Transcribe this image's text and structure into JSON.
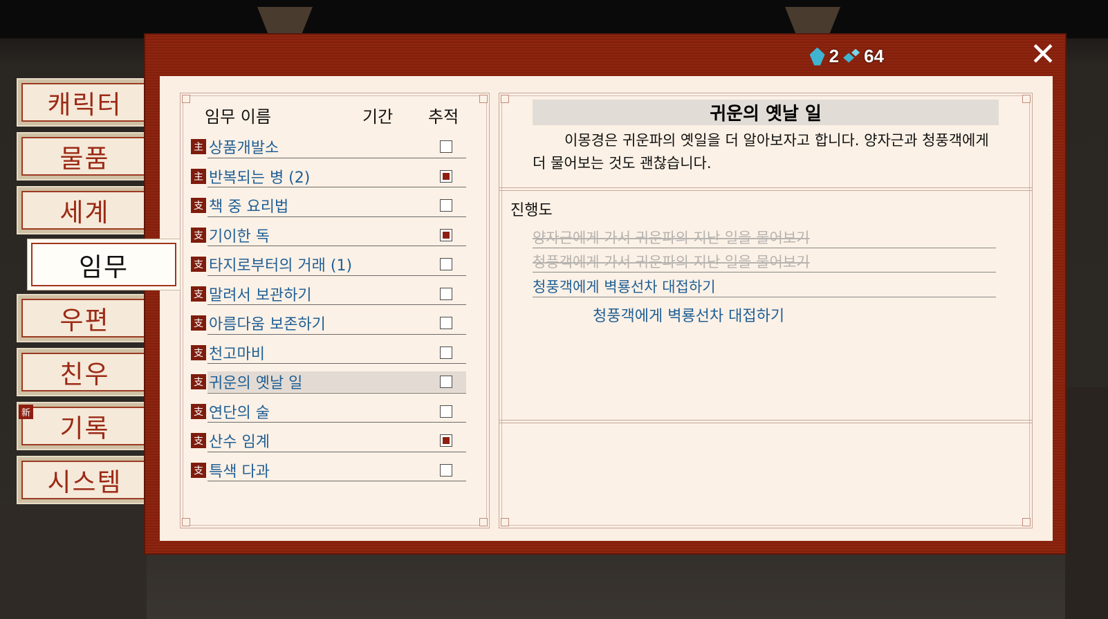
{
  "tabs": [
    {
      "label": "캐릭터",
      "active": false
    },
    {
      "label": "물품",
      "active": false
    },
    {
      "label": "세계",
      "active": false
    },
    {
      "label": "임무",
      "active": true
    },
    {
      "label": "우편",
      "active": false
    },
    {
      "label": "친우",
      "active": false
    },
    {
      "label": "기록",
      "active": false
    },
    {
      "label": "시스템",
      "active": false
    }
  ],
  "new_badge": "新",
  "currency": {
    "gems": "2",
    "gem_shards": "64"
  },
  "quest_list": {
    "header": {
      "name": "임무 이름",
      "period": "기간",
      "track": "추적"
    },
    "quests": [
      {
        "type": "主",
        "name": "상품개발소",
        "tracked": false
      },
      {
        "type": "主",
        "name": "반복되는 병 (2)",
        "tracked": true
      },
      {
        "type": "支",
        "name": "책 중 요리법",
        "tracked": false
      },
      {
        "type": "支",
        "name": "기이한 독",
        "tracked": true
      },
      {
        "type": "支",
        "name": "타지로부터의 거래 (1)",
        "tracked": false
      },
      {
        "type": "支",
        "name": "말려서 보관하기",
        "tracked": false
      },
      {
        "type": "支",
        "name": "아름다움 보존하기",
        "tracked": false
      },
      {
        "type": "支",
        "name": "천고마비",
        "tracked": false
      },
      {
        "type": "支",
        "name": "귀운의 옛날 일",
        "tracked": false,
        "selected": true
      },
      {
        "type": "支",
        "name": "연단의 술",
        "tracked": false
      },
      {
        "type": "支",
        "name": "산수 임계",
        "tracked": true
      },
      {
        "type": "支",
        "name": "특색 다과",
        "tracked": false
      }
    ]
  },
  "detail": {
    "title": "귀운의 옛날 일",
    "description": "이몽경은 귀운파의 옛일을 더 알아보자고 합니다. 양자근과 청풍객에게 더 물어보는 것도 괜찮습니다.",
    "progress_label": "진행도",
    "steps": [
      {
        "text": "양자근에게 가서 귀운파의 지난 일을 물어보기",
        "done": true
      },
      {
        "text": "청풍객에게 가서 귀운파의 지난 일을 물어보기",
        "done": true
      },
      {
        "text": "청풍객에게 벽룡선차 대접하기",
        "done": false
      }
    ],
    "current_goal": "청풍객에게 벽룡선차 대접하기"
  }
}
